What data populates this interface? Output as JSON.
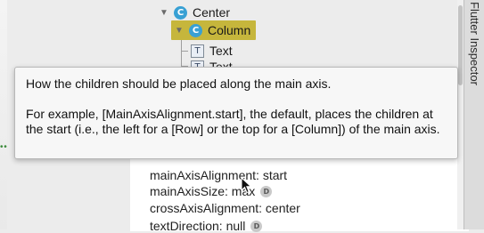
{
  "side_panel": {
    "title": "Flutter Inspector"
  },
  "tree": {
    "nodes": [
      {
        "badge": "C",
        "label": "Center",
        "expanded": true
      },
      {
        "badge": "C",
        "label": "Column",
        "expanded": true,
        "selected": true
      },
      {
        "badge": "T",
        "label": "Text"
      },
      {
        "badge": "T",
        "label": "Text"
      }
    ]
  },
  "tooltip": {
    "line1": "How the children should be placed along the main axis.",
    "line2": "For example, [MainAxisAlignment.start], the default, places the children at the start (i.e., the left for a [Row] or the top for a [Column]) of the main axis."
  },
  "properties": [
    {
      "text": "mainAxisAlignment: start",
      "default_badge": ""
    },
    {
      "text": "mainAxisSize: max",
      "default_badge": "D"
    },
    {
      "text": "crossAxisAlignment: center",
      "default_badge": ""
    },
    {
      "text": "textDirection: null",
      "default_badge": "D"
    }
  ],
  "colors": {
    "selection": "#c6b63c",
    "class_badge": "#38a0d4",
    "tooltip_bg": "#f7f7f7"
  }
}
